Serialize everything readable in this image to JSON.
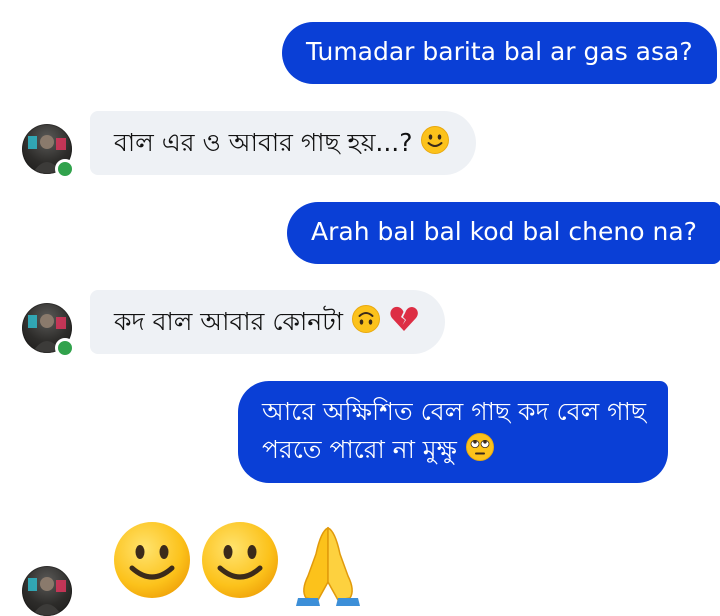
{
  "conversation": {
    "messages": [
      {
        "direction": "outgoing",
        "text": "Tumadar barita bal ar gas asa?"
      },
      {
        "direction": "incoming",
        "text": "বাল এর ও আবার গাছ হয়...?",
        "emoji": "slightly-smiling-face"
      },
      {
        "direction": "outgoing",
        "text": "Arah bal bal kod bal cheno na?"
      },
      {
        "direction": "incoming",
        "text": "কদ বাল আবার কোনটা",
        "emoji": [
          "upside-down-face",
          "broken-heart"
        ]
      },
      {
        "direction": "outgoing",
        "lines": [
          "আরে অক্ষিশিত বেল গাছ কদ বেল গাছ",
          "পরতে পারো না মুক্ষু"
        ],
        "emoji": "face-with-rolling-eyes"
      },
      {
        "direction": "incoming",
        "emoji_only": [
          "slightly-smiling-face",
          "slightly-smiling-face",
          "folded-hands"
        ]
      }
    ]
  },
  "colors": {
    "outgoing_bubble": "#0a3fd6",
    "incoming_bubble": "#eef1f5",
    "online_status": "#31a24c"
  }
}
